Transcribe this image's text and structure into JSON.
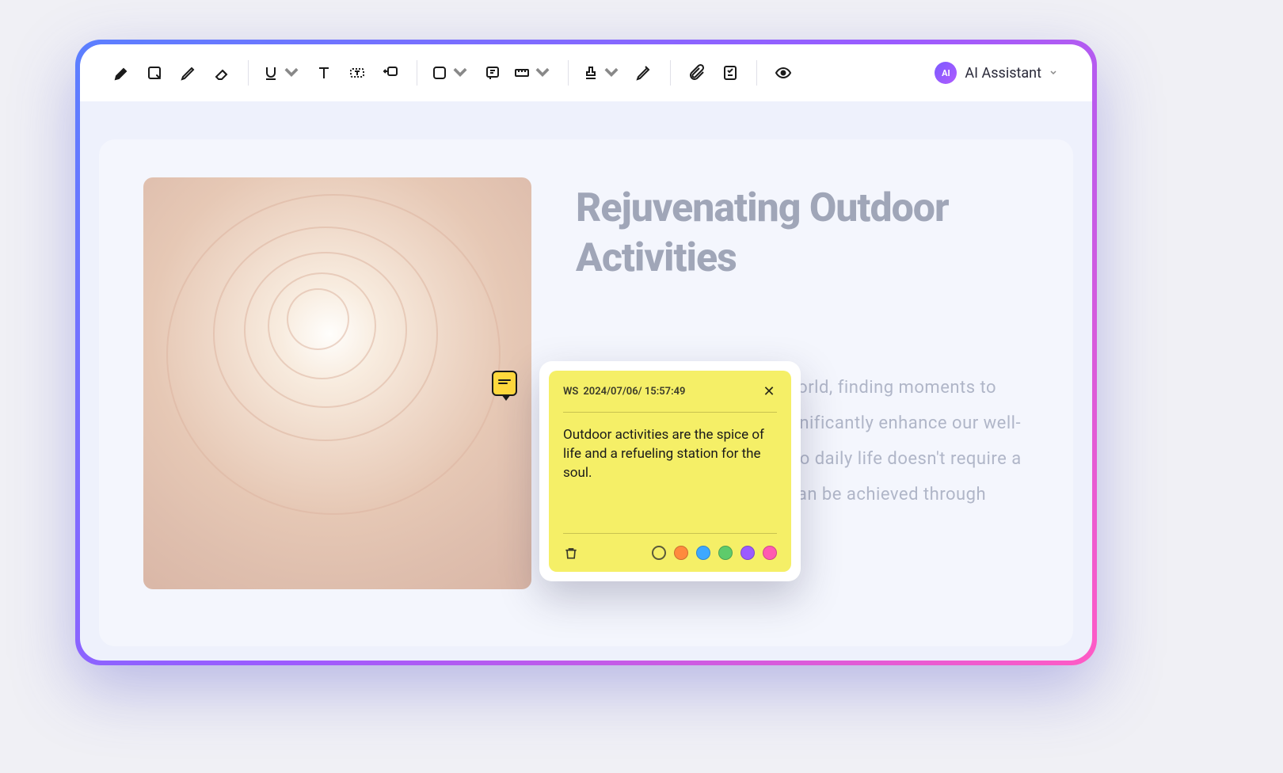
{
  "toolbar": {
    "ai_badge": "AI",
    "ai_label": "AI Assistant"
  },
  "document": {
    "heading": "Rejuvenating Outdoor Activities",
    "body": "In the fast-paced modern world, finding moments to connect with nature can significantly enhance our well-being. Integrating nature into daily life doesn't require a drastic lifestyle change; it can be achieved through simple, mindful practices."
  },
  "note": {
    "author": "WS",
    "timestamp": "2024/07/06/ 15:57:49",
    "body": "Outdoor activities are the spice of life and a refueling station for the soul.",
    "colors": {
      "hollow": "transparent",
      "orange": "#ff8a3d",
      "blue": "#3da8ff",
      "green": "#5ecb6b",
      "purple": "#9b5bff",
      "pink": "#ff5bb0"
    }
  }
}
